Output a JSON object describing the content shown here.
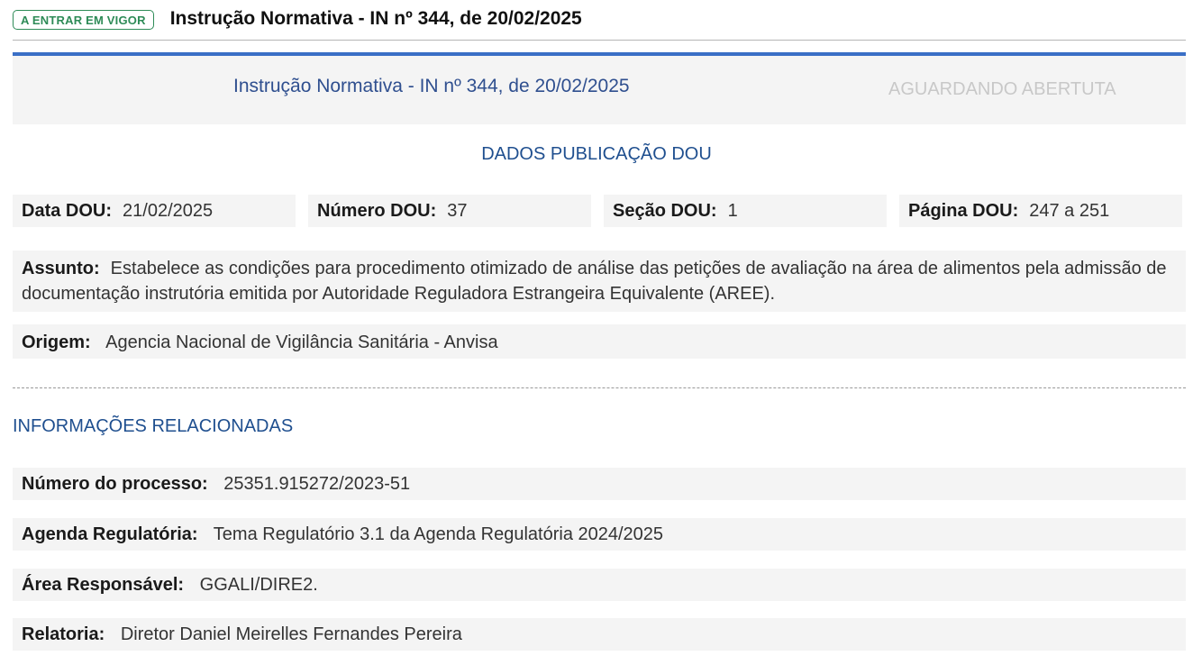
{
  "top": {
    "status_badge": "A ENTRAR EM VIGOR",
    "title": "Instrução Normativa - IN nº 344, de 20/02/2025"
  },
  "header": {
    "title": "Instrução Normativa - IN nº 344, de 20/02/2025",
    "status": "AGUARDANDO ABERTUTA"
  },
  "dou": {
    "section_title": "DADOS PUBLICAÇÃO DOU",
    "data_label": "Data DOU:",
    "data_value": "21/02/2025",
    "numero_label": "Número DOU:",
    "numero_value": "37",
    "secao_label": "Seção DOU:",
    "secao_value": "1",
    "pagina_label": "Página DOU:",
    "pagina_value": "247 a 251"
  },
  "assunto": {
    "label": "Assunto:",
    "value": "Estabelece as condições para procedimento otimizado de análise das petições de avaliação na área de alimentos pela admissão de documentação instrutória emitida por Autoridade Reguladora Estrangeira Equivalente (AREE)."
  },
  "origem": {
    "label": "Origem:",
    "value": "Agencia Nacional de Vigilância Sanitária - Anvisa"
  },
  "related": {
    "section_title": "INFORMAÇÕES RELACIONADAS",
    "processo_label": "Número do processo:",
    "processo_value": "25351.915272/2023-51",
    "agenda_label": "Agenda Regulatória:",
    "agenda_value": "Tema Regulatório 3.1 da Agenda Regulatória 2024/2025",
    "area_label": "Área Responsável:",
    "area_value": "GGALI/DIRE2.",
    "relatoria_label": "Relatoria:",
    "relatoria_value": "Diretor Daniel Meirelles Fernandes Pereira"
  },
  "colors": {
    "accent_blue": "#3a6fc6",
    "heading_blue": "#1f4f8f",
    "status_green": "#2e8b57",
    "panel_gray": "#f4f4f4"
  }
}
